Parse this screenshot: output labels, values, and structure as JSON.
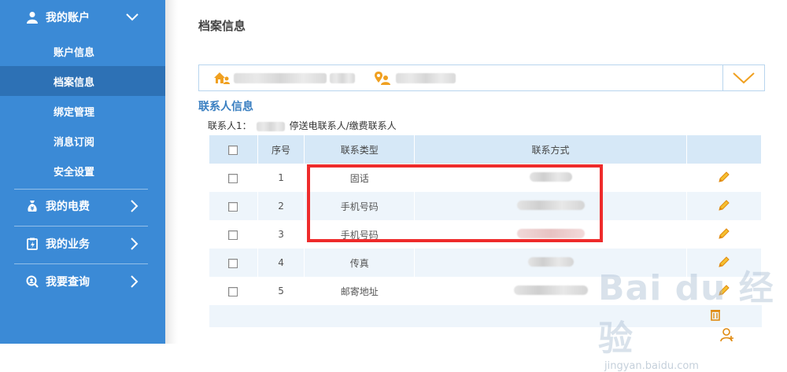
{
  "sidebar": {
    "account": {
      "label": "我的账户",
      "icon": "user-icon"
    },
    "sub_items": [
      {
        "label": "账户信息"
      },
      {
        "label": "档案信息"
      },
      {
        "label": "绑定管理"
      },
      {
        "label": "消息订阅"
      },
      {
        "label": "安全设置"
      }
    ],
    "fees": {
      "label": "我的电费",
      "icon": "money-bag-icon"
    },
    "business": {
      "label": "我的业务",
      "icon": "clipboard-icon"
    },
    "query": {
      "label": "我要查询",
      "icon": "search-icon"
    }
  },
  "main": {
    "page_title": "档案信息",
    "section_title": "联系人信息",
    "contact_label": "联系人1：",
    "contact_roles": "停送电联系人/缴费联系人",
    "table": {
      "headers": [
        "",
        "序号",
        "联系类型",
        "联系方式",
        ""
      ],
      "rows": [
        {
          "no": "1",
          "type": "固话"
        },
        {
          "no": "2",
          "type": "手机号码"
        },
        {
          "no": "3",
          "type": "手机号码"
        },
        {
          "no": "4",
          "type": "传真"
        },
        {
          "no": "5",
          "type": "邮寄地址"
        }
      ]
    }
  },
  "watermark": {
    "brand": "Bai du 经验",
    "url": "jingyan.baidu.com"
  },
  "colors": {
    "sidebar": "#3b8ad6",
    "active": "#2d71b5",
    "accent": "#3a7fc1",
    "highlight": "#ee2b2b",
    "icon_orange": "#f0a020"
  }
}
